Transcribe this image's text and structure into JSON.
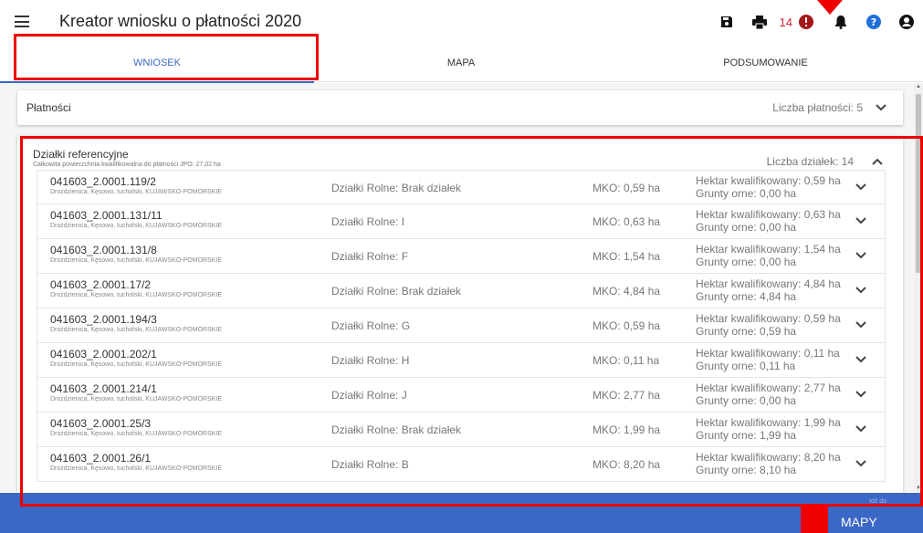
{
  "header": {
    "title": "Kreator wniosku o płatności 2020",
    "notification_count": "14",
    "icons": [
      "menu-icon",
      "save-icon",
      "print-icon",
      "alert-icon",
      "bell-icon",
      "help-icon",
      "account-icon"
    ]
  },
  "tabs": [
    {
      "label": "WNIOSEK",
      "active": true
    },
    {
      "label": "MAPA",
      "active": false
    },
    {
      "label": "PODSUMOWANIE",
      "active": false
    }
  ],
  "payments": {
    "title": "Płatności",
    "count_label": "Liczba płatności: 5"
  },
  "plots": {
    "title": "Działki referencyjne",
    "subtitle": "Całkowita powierzchnia kwalifikowalna do płatności JPO: 27,02 ha",
    "count_label": "Liczba działek: 14",
    "rows": [
      {
        "id": "041603_2.0001.119/2",
        "location": "Drożdzienica, Kęsowo, tucholski, KUJAWSKO-POMORSKIE",
        "rolne": "Działki Rolne: Brak działek",
        "mko": "MKO: 0,59 ha",
        "hektar": "Hektar kwalifikowany: 0,59 ha",
        "grunty": "Grunty orne: 0,00 ha"
      },
      {
        "id": "041603_2.0001.131/11",
        "location": "Drożdzienica, Kęsowo, tucholski, KUJAWSKO-POMORSKIE",
        "rolne": "Działki Rolne: I",
        "mko": "MKO: 0,63 ha",
        "hektar": "Hektar kwalifikowany: 0,63 ha",
        "grunty": "Grunty orne: 0,00 ha"
      },
      {
        "id": "041603_2.0001.131/8",
        "location": "Drożdzienica, Kęsowo, tucholski, KUJAWSKO-POMORSKIE",
        "rolne": "Działki Rolne: F",
        "mko": "MKO: 1,54 ha",
        "hektar": "Hektar kwalifikowany: 1,54 ha",
        "grunty": "Grunty orne: 0,00 ha"
      },
      {
        "id": "041603_2.0001.17/2",
        "location": "Drożdzienica, Kęsowo, tucholski, KUJAWSKO-POMORSKIE",
        "rolne": "Działki Rolne: Brak działek",
        "mko": "MKO: 4,84 ha",
        "hektar": "Hektar kwalifikowany: 4,84 ha",
        "grunty": "Grunty orne: 4,84 ha"
      },
      {
        "id": "041603_2.0001.194/3",
        "location": "Drożdzienica, Kęsowo, tucholski, KUJAWSKO-POMORSKIE",
        "rolne": "Działki Rolne: G",
        "mko": "MKO: 0,59 ha",
        "hektar": "Hektar kwalifikowany: 0,59 ha",
        "grunty": "Grunty orne: 0,59 ha"
      },
      {
        "id": "041603_2.0001.202/1",
        "location": "Drożdzienica, Kęsowo, tucholski, KUJAWSKO-POMORSKIE",
        "rolne": "Działki Rolne: H",
        "mko": "MKO: 0,11 ha",
        "hektar": "Hektar kwalifikowany: 0,11 ha",
        "grunty": "Grunty orne: 0,11 ha"
      },
      {
        "id": "041603_2.0001.214/1",
        "location": "Drożdzienica, Kęsowo, tucholski, KUJAWSKO-POMORSKIE",
        "rolne": "Działki Rolne: J",
        "mko": "MKO: 2,77 ha",
        "hektar": "Hektar kwalifikowany: 2,77 ha",
        "grunty": "Grunty orne: 0,00 ha"
      },
      {
        "id": "041603_2.0001.25/3",
        "location": "Drożdzienica, Kęsowo, tucholski, KUJAWSKO-POMORSKIE",
        "rolne": "Działki Rolne: Brak działek",
        "mko": "MKO: 1,99 ha",
        "hektar": "Hektar kwalifikowany: 1,99 ha",
        "grunty": "Grunty orne: 1,99 ha"
      },
      {
        "id": "041603_2.0001.26/1",
        "location": "Drożdzienica, Kęsowo, tucholski, KUJAWSKO-POMORSKIE",
        "rolne": "Działki Rolne: B",
        "mko": "MKO: 8,20 ha",
        "hektar": "Hektar kwalifikowany: 8,20 ha",
        "grunty": "Grunty orne: 8,10 ha"
      }
    ]
  },
  "footer": {
    "small_label": "Idź do",
    "maps_label": "MAPY"
  },
  "colors": {
    "accent": "#3a67c6",
    "footer_bg": "#3b67c6",
    "alert_red": "#d9232a",
    "help_blue": "#1f6fd6",
    "annotation_red": "#ee0000"
  }
}
